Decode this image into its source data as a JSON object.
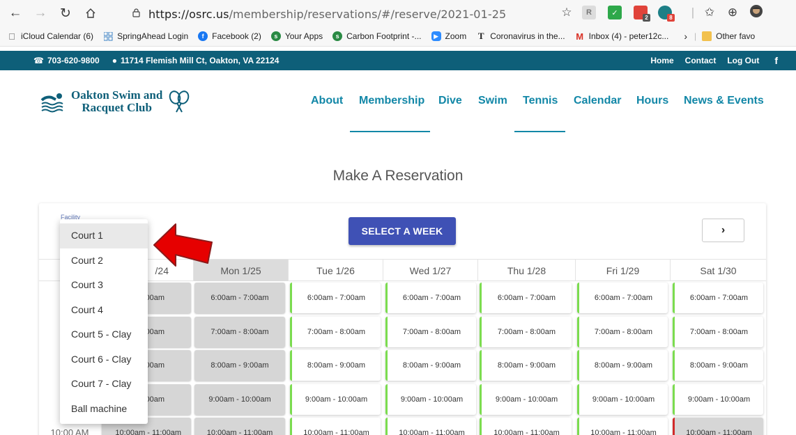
{
  "browser": {
    "url_host": "https://osrc.us",
    "url_path": "/membership/reservations/#/reserve/2021-01-25",
    "extension_badges": [
      "2",
      "8"
    ],
    "bookmarks": [
      {
        "label": "iCloud Calendar (6)",
        "icon": "apple-icon",
        "color": "#555555"
      },
      {
        "label": "SpringAhead Login",
        "icon": "grid-icon",
        "color": "#3b82c4"
      },
      {
        "label": "Facebook (2)",
        "icon": "facebook-icon",
        "color": "#1877f2"
      },
      {
        "label": "Your Apps",
        "icon": "app-icon",
        "color": "#2a8a44"
      },
      {
        "label": "Carbon Footprint -...",
        "icon": "app-icon",
        "color": "#2a8a44"
      },
      {
        "label": "Zoom",
        "icon": "zoom-icon",
        "color": "#2d8cff"
      },
      {
        "label": "Coronavirus in the...",
        "icon": "nyt-icon",
        "color": "#222222"
      },
      {
        "label": "Inbox (4) - peter12c...",
        "icon": "gmail-icon",
        "color": "#d93025"
      }
    ],
    "other_favorites": "Other favo"
  },
  "site": {
    "phone": "703-620-9800",
    "address": "11714 Flemish Mill Ct, Oakton, VA 22124",
    "top_links": [
      "Home",
      "Contact",
      "Log Out"
    ],
    "facebook_glyph": "f",
    "logo_line1": "Oakton Swim and",
    "logo_line2": "Racquet Club",
    "nav": [
      "About",
      "Membership",
      "Dive",
      "Swim",
      "Tennis",
      "Calendar",
      "Hours",
      "News & Events"
    ],
    "active_nav": [
      "Membership",
      "Tennis"
    ],
    "accent_color": "#1287a7",
    "topbar_color": "#0e5f79"
  },
  "reservation": {
    "title": "Make A Reservation",
    "facility_label": "Facility",
    "select_week_label": "SELECT A WEEK",
    "next_glyph": "›",
    "days": [
      "Sun 1/24",
      "Mon 1/25",
      "Tue 1/26",
      "Wed 1/27",
      "Thu 1/28",
      "Fri 1/29",
      "Sat 1/30"
    ],
    "today_index": 1,
    "visible_sunday_header": "/24",
    "time_labels": [
      "6:(",
      "7:(",
      "8:(",
      "9:(",
      "10:00 AM"
    ],
    "slots": [
      {
        "label": "6:00am - 7:00am",
        "sunday_label": "7:00am"
      },
      {
        "label": "7:00am - 8:00am",
        "sunday_label": "8:00am"
      },
      {
        "label": "8:00am - 9:00am",
        "sunday_label": "9:00am"
      },
      {
        "label": "9:00am - 10:00am",
        "sunday_label": "10:00am"
      },
      {
        "label": "10:00am - 11:00am",
        "sunday_label": "10:00am - 11:00am"
      }
    ],
    "open_color": "#7bdc4f",
    "booked_color": "#d12a2a"
  },
  "facility_dropdown": {
    "options": [
      "Court 1",
      "Court 2",
      "Court 3",
      "Court 4",
      "Court 5 - Clay",
      "Court 6 - Clay",
      "Court 7 - Clay",
      "Ball machine"
    ],
    "selected_index": 0
  }
}
